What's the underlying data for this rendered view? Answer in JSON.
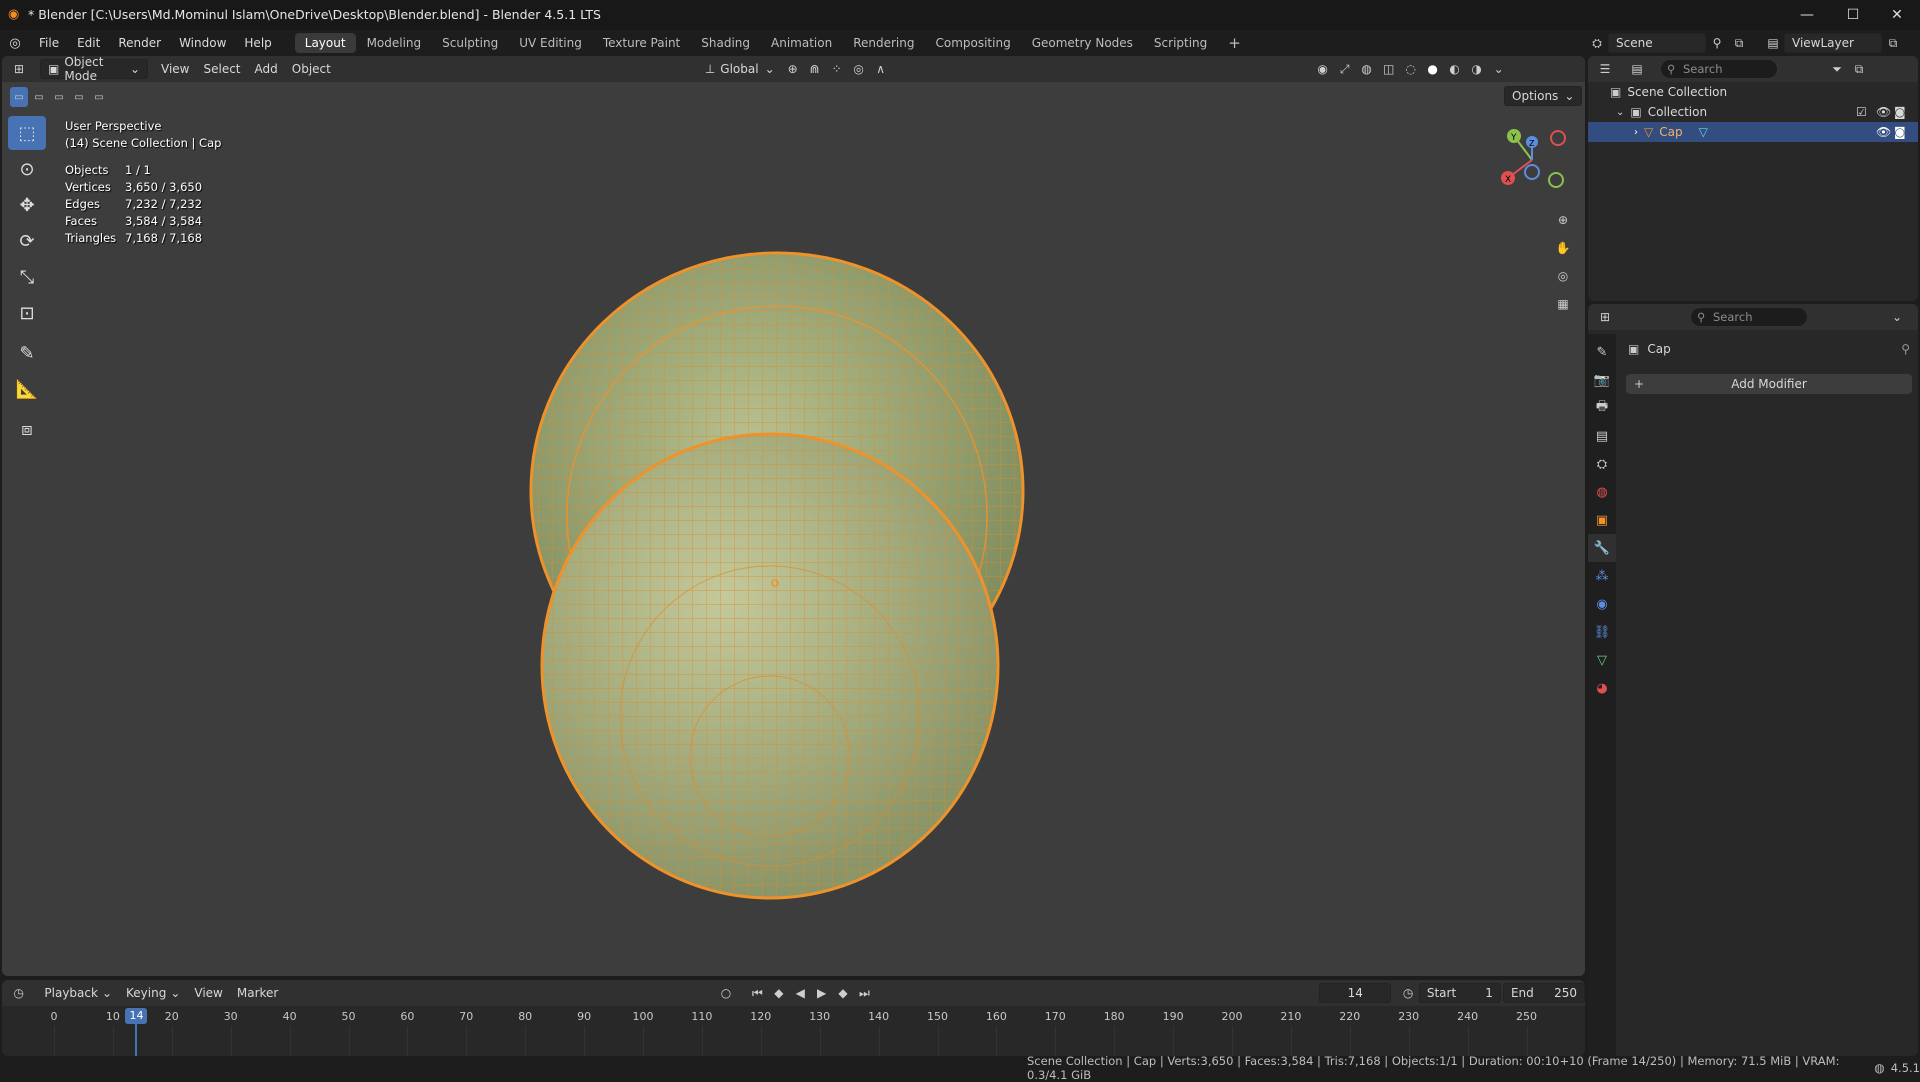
{
  "window": {
    "title": "* Blender [C:\\Users\\Md.Mominul Islam\\OneDrive\\Desktop\\Blender.blend] - Blender 4.5.1 LTS",
    "controls": [
      "—",
      "☐",
      "✕"
    ]
  },
  "menu": [
    "File",
    "Edit",
    "Render",
    "Window",
    "Help"
  ],
  "workspaces": [
    "Layout",
    "Modeling",
    "Sculpting",
    "UV Editing",
    "Texture Paint",
    "Shading",
    "Animation",
    "Rendering",
    "Compositing",
    "Geometry Nodes",
    "Scripting"
  ],
  "active_workspace": "Layout",
  "viewport_header": {
    "mode": "Object Mode",
    "menus": [
      "View",
      "Select",
      "Add",
      "Object"
    ],
    "transform_orientation": "Global",
    "options": "Options"
  },
  "overlay": {
    "view_name": "User Perspective",
    "collection_path": "(14) Scene Collection | Cap",
    "stats": [
      {
        "label": "Objects",
        "value": "1 / 1"
      },
      {
        "label": "Vertices",
        "value": "3,650 / 3,650"
      },
      {
        "label": "Edges",
        "value": "7,232 / 7,232"
      },
      {
        "label": "Faces",
        "value": "3,584 / 3,584"
      },
      {
        "label": "Triangles",
        "value": "7,168 / 7,168"
      }
    ]
  },
  "gizmo": {
    "y": "Y",
    "z": "Z",
    "x": "X"
  },
  "topbar_right": {
    "scene": "Scene",
    "view_layer": "ViewLayer"
  },
  "outliner": {
    "search_placeholder": "Search",
    "scene_collection": "Scene Collection",
    "collection": "Collection",
    "object": "Cap"
  },
  "properties": {
    "search_placeholder": "Search",
    "object_name": "Cap",
    "add_modifier": "Add Modifier"
  },
  "timeline": {
    "menus": [
      "Playback",
      "Keying",
      "View",
      "Marker"
    ],
    "current_frame": "14",
    "start_label": "Start",
    "start": "1",
    "end_label": "End",
    "end": "250",
    "ruler": [
      "0",
      "10",
      "20",
      "30",
      "40",
      "50",
      "60",
      "70",
      "80",
      "90",
      "100",
      "110",
      "120",
      "130",
      "140",
      "150",
      "160",
      "170",
      "180",
      "190",
      "200",
      "210",
      "220",
      "230",
      "240",
      "250"
    ]
  },
  "statusbar": {
    "text": "Scene Collection | Cap | Verts:3,650 | Faces:3,584 | Tris:7,168 | Objects:1/1 | Duration: 00:10+10 (Frame 14/250) | Memory: 71.5 MiB | VRAM: 0.3/4.1 GiB",
    "version": "4.5.1"
  },
  "colors": {
    "accent": "#4772b3",
    "selection": "#f0922a",
    "mesh": "#a6b07c"
  }
}
